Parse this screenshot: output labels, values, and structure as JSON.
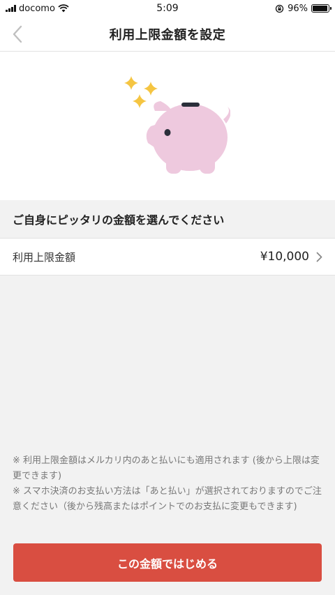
{
  "status_bar": {
    "carrier": "docomo",
    "time": "5:09",
    "battery_percent": "96%",
    "battery_level": 0.96,
    "icons": [
      "signal-icon",
      "wifi-icon",
      "rotation-lock-icon",
      "battery-icon"
    ]
  },
  "nav": {
    "title": "利用上限金額を設定",
    "back_icon": "chevron-left-icon"
  },
  "hero": {
    "illustration": "piggy-bank-with-sparkles",
    "colors": {
      "pig": "#eec9de",
      "sparkle": "#f5c542",
      "eye": "#2a2f3a"
    }
  },
  "section": {
    "heading": "ご自身にピッタリの金額を選んでください"
  },
  "limit_row": {
    "label": "利用上限金額",
    "value": "¥10,000",
    "icon": "chevron-right-icon"
  },
  "notes": {
    "note1": "※ 利用上限金額はメルカリ内のあと払いにも適用されます (後から上限は変更できます)",
    "note2": "※ スマホ決済のお支払い方法は「あと払い」が選択されておりますのでご注意ください（後から残高またはポイントでのお支払に変更もできます)"
  },
  "cta": {
    "label": "この金額ではじめる",
    "color": "#d94e41"
  }
}
